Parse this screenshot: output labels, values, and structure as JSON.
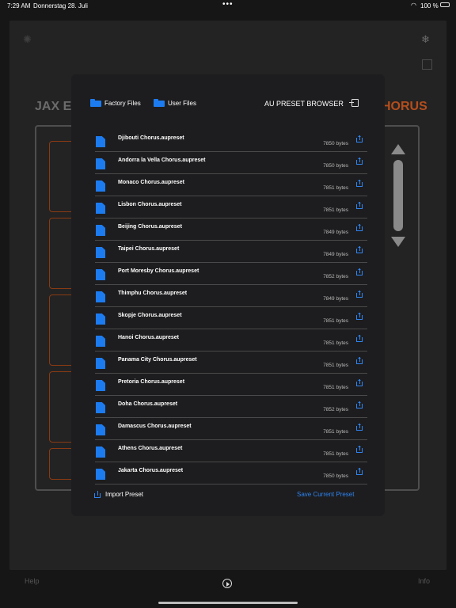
{
  "status_bar": {
    "time": "7:29 AM",
    "date": "Donnerstag 28. Juli",
    "dots": "•••",
    "battery": "100 %"
  },
  "plugin": {
    "title_left": "JAX ES",
    "title_right": "HORUS",
    "help_label": "Help",
    "info_label": "Info",
    "accent_color": "#b44e1c"
  },
  "browser": {
    "title": "AU PRESET BROWSER",
    "tabs": [
      {
        "label": "Factory Files"
      },
      {
        "label": "User Files"
      }
    ],
    "files": [
      {
        "name": "Djibouti Chorus.aupreset",
        "size": "7850 bytes"
      },
      {
        "name": "Andorra la Vella Chorus.aupreset",
        "size": "7850 bytes"
      },
      {
        "name": "Monaco Chorus.aupreset",
        "size": "7851 bytes"
      },
      {
        "name": "Lisbon Chorus.aupreset",
        "size": "7851 bytes"
      },
      {
        "name": "Beijing Chorus.aupreset",
        "size": "7849 bytes"
      },
      {
        "name": "Taipei Chorus.aupreset",
        "size": "7849 bytes"
      },
      {
        "name": "Port Moresby Chorus.aupreset",
        "size": "7852 bytes"
      },
      {
        "name": "Thimphu Chorus.aupreset",
        "size": "7849 bytes"
      },
      {
        "name": "Skopje Chorus.aupreset",
        "size": "7851 bytes"
      },
      {
        "name": "Hanoi Chorus.aupreset",
        "size": "7851 bytes"
      },
      {
        "name": "Panama City Chorus.aupreset",
        "size": "7851 bytes"
      },
      {
        "name": "Pretoria Chorus.aupreset",
        "size": "7851 bytes"
      },
      {
        "name": "Doha Chorus.aupreset",
        "size": "7852 bytes"
      },
      {
        "name": "Damascus Chorus.aupreset",
        "size": "7851 bytes"
      },
      {
        "name": "Athens Chorus.aupreset",
        "size": "7851 bytes"
      },
      {
        "name": "Jakarta Chorus.aupreset",
        "size": "7850 bytes"
      }
    ],
    "import_label": "Import Preset",
    "save_label": "Save Current Preset",
    "accent_color": "#1d7bf0"
  }
}
